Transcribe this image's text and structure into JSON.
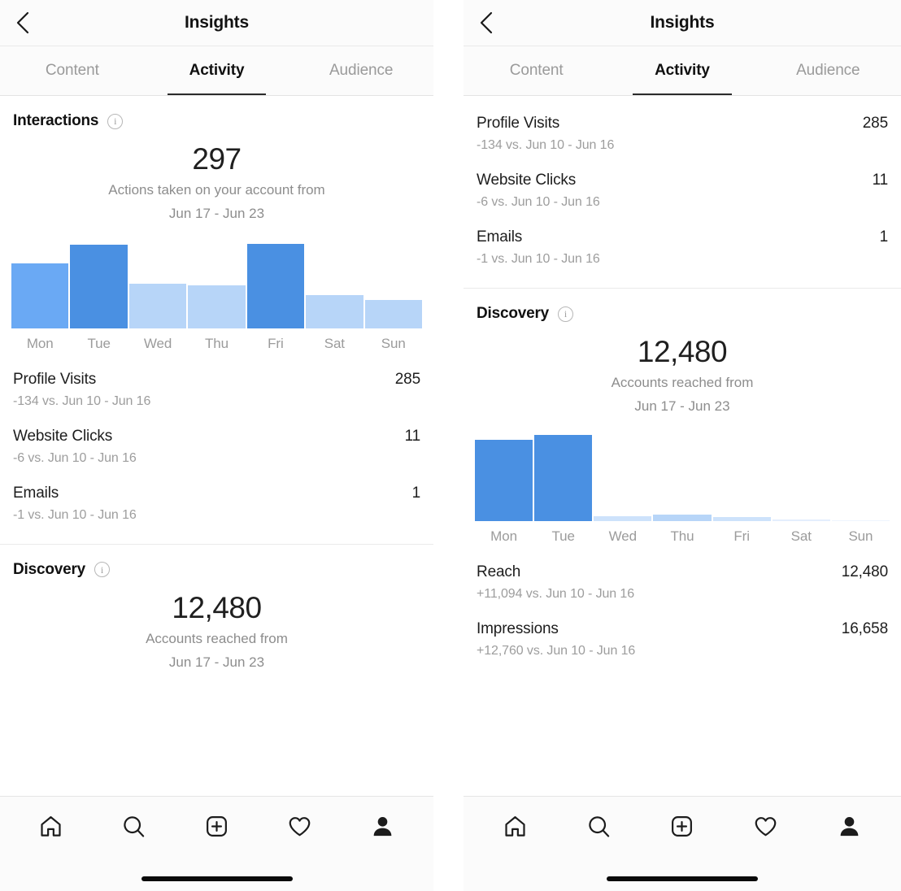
{
  "colors": {
    "bar_dark": "#4a90e2",
    "bar_mid": "#6aa9f4",
    "bar_light": "#b7d5f8",
    "bar_lighter": "#cde2fb",
    "bar_faint": "#e4eefd",
    "text_primary": "#1d1d1d",
    "text_muted": "#9d9d9d",
    "accent_underline": "#2b2b2b"
  },
  "left": {
    "nav": {
      "back_icon": "chevron-left-icon",
      "title": "Insights"
    },
    "tabs": [
      {
        "label": "Content",
        "active": false
      },
      {
        "label": "Activity",
        "active": true
      },
      {
        "label": "Audience",
        "active": false
      }
    ],
    "interactions": {
      "title": "Interactions",
      "info_icon": "info-icon",
      "value": "297",
      "caption_line1": "Actions taken on your account from",
      "caption_line2": "Jun 17 - Jun 23"
    },
    "metrics": [
      {
        "name": "Profile Visits",
        "value": "285",
        "delta": "-134 vs. Jun 10 - Jun 16"
      },
      {
        "name": "Website Clicks",
        "value": "11",
        "delta": "-6 vs. Jun 10 - Jun 16"
      },
      {
        "name": "Emails",
        "value": "1",
        "delta": "-1 vs. Jun 10 - Jun 16"
      }
    ],
    "discovery": {
      "title": "Discovery",
      "info_icon": "info-icon",
      "value": "12,480",
      "caption_line1": "Accounts reached from",
      "caption_line2": "Jun 17 - Jun 23"
    }
  },
  "right": {
    "nav": {
      "back_icon": "chevron-left-icon",
      "title": "Insights"
    },
    "tabs": [
      {
        "label": "Content",
        "active": false
      },
      {
        "label": "Activity",
        "active": true
      },
      {
        "label": "Audience",
        "active": false
      }
    ],
    "metrics": [
      {
        "name": "Profile Visits",
        "value": "285",
        "delta": "-134 vs. Jun 10 - Jun 16"
      },
      {
        "name": "Website Clicks",
        "value": "11",
        "delta": "-6 vs. Jun 10 - Jun 16"
      },
      {
        "name": "Emails",
        "value": "1",
        "delta": "-1 vs. Jun 10 - Jun 16"
      }
    ],
    "discovery": {
      "title": "Discovery",
      "info_icon": "info-icon",
      "value": "12,480",
      "caption_line1": "Accounts reached from",
      "caption_line2": "Jun 17 - Jun 23"
    },
    "metrics2": [
      {
        "name": "Reach",
        "value": "12,480",
        "delta": "+11,094 vs. Jun 10 - Jun 16"
      },
      {
        "name": "Impressions",
        "value": "16,658",
        "delta": "+12,760 vs. Jun 10 - Jun 16"
      }
    ]
  },
  "tabbar": {
    "items": [
      {
        "icon": "home-icon",
        "label": "Home"
      },
      {
        "icon": "search-icon",
        "label": "Search"
      },
      {
        "icon": "add-post-icon",
        "label": "Create"
      },
      {
        "icon": "heart-icon",
        "label": "Activity"
      },
      {
        "icon": "profile-icon",
        "label": "Profile"
      }
    ],
    "home_indicator": "home-indicator"
  },
  "chart_data": [
    {
      "type": "bar",
      "id": "interactions-weekly",
      "title": "Interactions",
      "subtitle": "Actions taken on your account from Jun 17 - Jun 23",
      "total": 297,
      "xlabel": "",
      "ylabel": "Interactions",
      "grid": false,
      "legend": false,
      "ylim": [
        0,
        64
      ],
      "categories": [
        "Mon",
        "Tue",
        "Wed",
        "Thu",
        "Fri",
        "Sat",
        "Sun"
      ],
      "values": [
        48,
        62,
        33,
        32,
        63,
        25,
        21
      ],
      "bar_colors": [
        "#6aa9f4",
        "#4a90e2",
        "#b7d5f8",
        "#b7d5f8",
        "#4a90e2",
        "#b7d5f8",
        "#b7d5f8"
      ]
    },
    {
      "type": "bar",
      "id": "discovery-weekly",
      "title": "Discovery",
      "subtitle": "Accounts reached from Jun 17 - Jun 23",
      "total": 12480,
      "xlabel": "",
      "ylabel": "Accounts reached",
      "grid": false,
      "legend": false,
      "ylim": [
        0,
        100
      ],
      "categories": [
        "Mon",
        "Tue",
        "Wed",
        "Thu",
        "Fri",
        "Sat",
        "Sun"
      ],
      "values": [
        94,
        100,
        6,
        8,
        5,
        2,
        1
      ],
      "bar_colors": [
        "#4a90e2",
        "#4a90e2",
        "#cde2fb",
        "#b7d5f8",
        "#cde2fb",
        "#e4eefd",
        "#eef4fe"
      ]
    }
  ]
}
